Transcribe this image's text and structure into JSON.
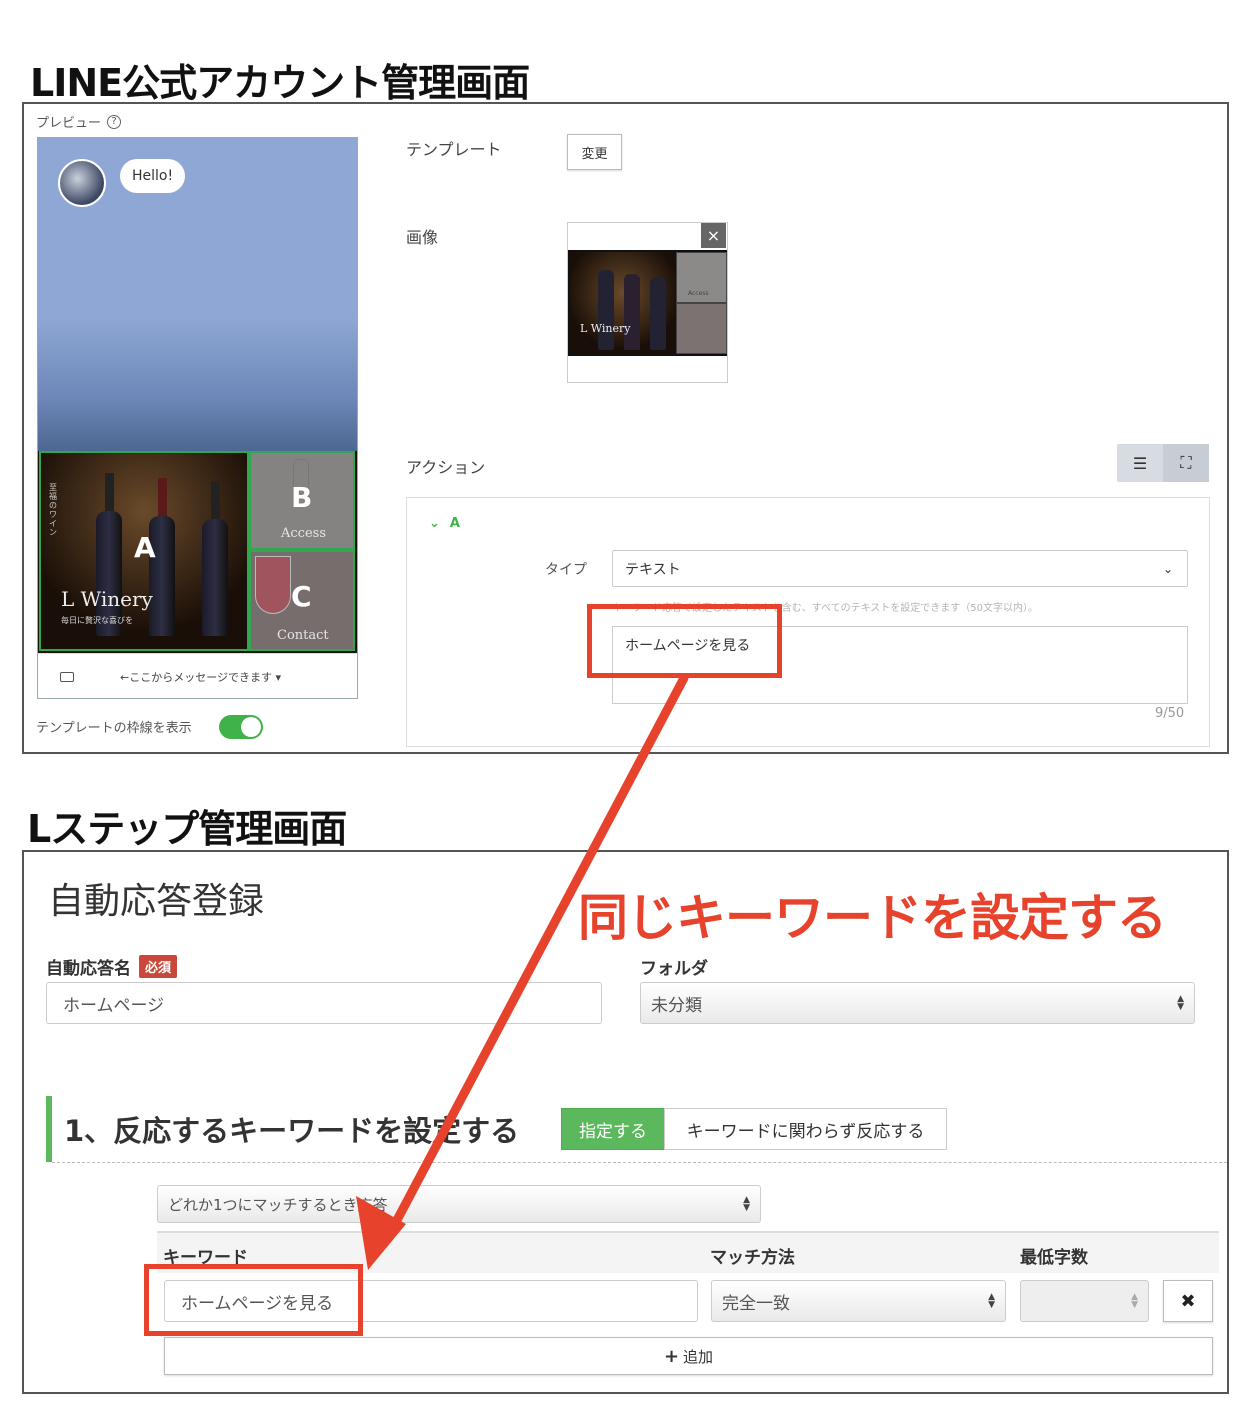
{
  "line_admin": {
    "section_title": "LINE公式アカウント管理画面",
    "preview_label": "プレビュー",
    "help_icon": "?",
    "bubble_text": "Hello!",
    "cells": {
      "a_letter": "A",
      "a_brand": "L Winery",
      "a_tagline": "毎日に贅沢な喜びを",
      "a_vertical": "至福のワイン",
      "b_letter": "B",
      "b_label": "Access",
      "c_letter": "C",
      "c_label": "Contact"
    },
    "message_bar": "←ここからメッセージできます ▾",
    "toggle_label": "テンプレートの枠線を表示",
    "toggle_on": true,
    "template_label": "テンプレート",
    "change_button": "変更",
    "image_label": "画像",
    "thumb_brand": "L Winery",
    "thumb_access": "Access",
    "action_label": "アクション",
    "action_item": "A",
    "type_label": "タイプ",
    "type_value": "テキスト",
    "hint": "キーワード応答で設定したテキストを含む、すべてのテキストを設定できます（50文字以内）。",
    "text_value": "ホームページを見る",
    "char_count": "9/50"
  },
  "lstep_admin": {
    "section_title": "Lステップ管理画面",
    "page_title": "自動応答登録",
    "callout": "同じキーワードを設定する",
    "name_label": "自動応答名",
    "required_badge": "必須",
    "name_value": "ホームページ",
    "folder_label": "フォルダ",
    "folder_value": "未分類",
    "step_heading": "1、反応するキーワードを設定する",
    "seg_specify": "指定する",
    "seg_any": "キーワードに関わらず反応する",
    "match_mode": "どれか1つにマッチするとき応答",
    "col_keyword": "キーワード",
    "col_match": "マッチ方法",
    "col_min": "最低字数",
    "keyword_value": "ホームページを見る",
    "match_value": "完全一致",
    "remove_icon": "✖",
    "add_label": "追加"
  },
  "colors": {
    "accent_red": "#e7432c",
    "green": "#5cb85c",
    "sky": "#8ea7d4"
  }
}
